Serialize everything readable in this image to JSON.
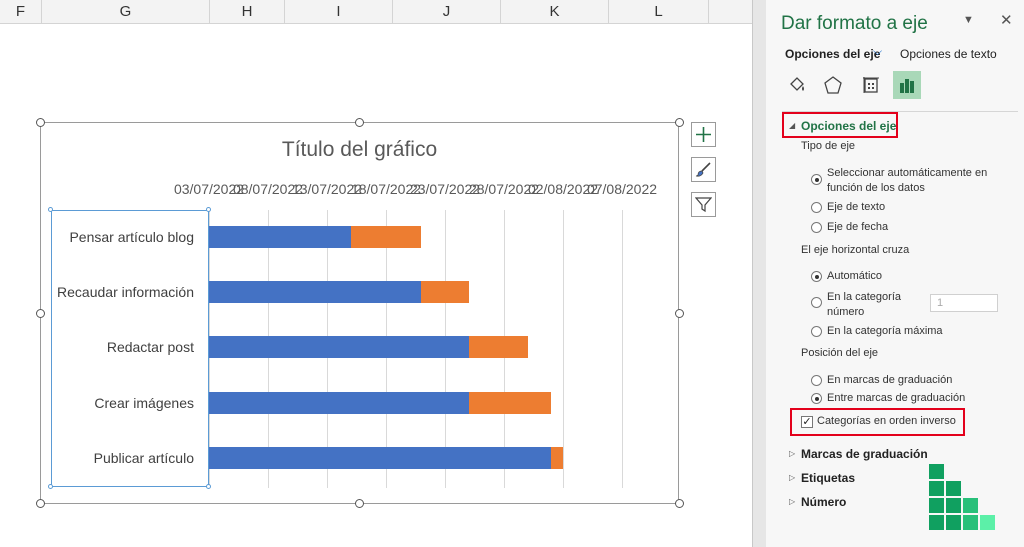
{
  "columns": [
    "F",
    "G",
    "H",
    "I",
    "J",
    "K",
    "L"
  ],
  "chart": {
    "title": "Título del gráfico",
    "dates": [
      "03/07/2022",
      "08/07/2022",
      "13/07/2022",
      "18/07/2022",
      "23/07/2022",
      "28/07/2022",
      "02/08/2022",
      "07/08/2022"
    ]
  },
  "chart_data": {
    "type": "bar",
    "orientation": "horizontal-stacked",
    "title": "Título del gráfico",
    "categories": [
      "Pensar artículo blog",
      "Recaudar información",
      "Redactar post",
      "Crear imágenes",
      "Publicar artículo"
    ],
    "series": [
      {
        "values": [
          "15/07/2022",
          "21/07/2022",
          "25/07/2022",
          "25/07/2022",
          "01/08/2022"
        ]
      },
      {
        "values": [
          6,
          4,
          5,
          7,
          1
        ]
      }
    ],
    "x_tick_labels": [
      "03/07/2022",
      "08/07/2022",
      "13/07/2022",
      "18/07/2022",
      "23/07/2022",
      "28/07/2022",
      "02/08/2022",
      "07/08/2022"
    ],
    "series_colors": [
      "#4472c4",
      "#ed7d31"
    ],
    "category_order": "reversed",
    "grid": true
  },
  "pane": {
    "title": "Dar formato a eje",
    "tab_axis_options": "Opciones del eje",
    "tab_text_options": "Opciones de texto",
    "icons": [
      "fill-line-icon",
      "effects-icon",
      "size-properties-icon",
      "axis-options-icon"
    ],
    "section_axis_options": "Opciones del eje",
    "axis_type_label": "Tipo de eje",
    "axis_type_options": [
      "Seleccionar automáticamente en función de los datos",
      "Eje de texto",
      "Eje de fecha"
    ],
    "axis_type_selected": 0,
    "horizontal_crosses_label": "El eje horizontal cruza",
    "crosses_options": [
      "Automático",
      "En la categoría número",
      "En la categoría máxima"
    ],
    "crosses_selected": 0,
    "category_number_value": "1",
    "axis_position_label": "Posición del eje",
    "position_options": [
      "En marcas de graduación",
      "Entre marcas de graduación"
    ],
    "position_selected": 1,
    "reverse_order_label": "Categorías en orden inverso",
    "reverse_order_checked": true,
    "more_sections": [
      "Marcas de graduación",
      "Etiquetas",
      "Número"
    ]
  },
  "colors": {
    "accent": "#217346",
    "highlight": "#e3001b",
    "series1": "#4472c4",
    "series2": "#ed7d31",
    "logo": "#10a060"
  }
}
